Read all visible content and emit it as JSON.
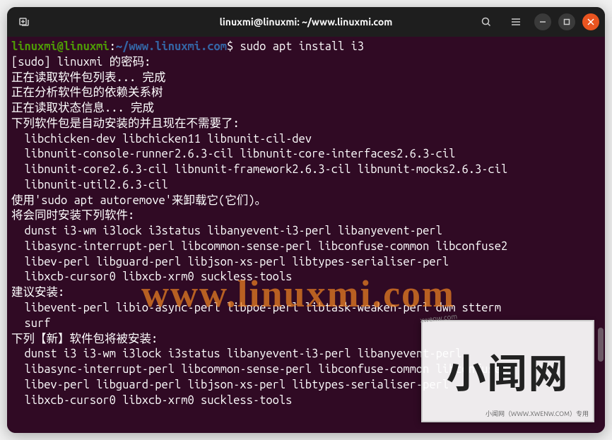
{
  "titlebar": {
    "title": "linuxmi@linuxmi: ~/www.linuxmi.com"
  },
  "prompt": {
    "user_host": "linuxmi@linuxmi",
    "sep": ":",
    "path": "~/www.linuxmi.com",
    "dollar": "$",
    "command": "sudo apt install i3"
  },
  "lines": {
    "l1": "[sudo] linuxmi 的密码:",
    "l2": "正在读取软件包列表... 完成",
    "l3": "正在分析软件包的依赖关系树",
    "l4": "正在读取状态信息... 完成",
    "l5": "下列软件包是自动安装的并且现在不需要了:",
    "l6": "libchicken-dev libchicken11 libnunit-cil-dev",
    "l7": "libnunit-console-runner2.6.3-cil libnunit-core-interfaces2.6.3-cil",
    "l8": "libnunit-core2.6.3-cil libnunit-framework2.6.3-cil libnunit-mocks2.6.3-cil",
    "l9": "libnunit-util2.6.3-cil",
    "l10": "使用'sudo apt autoremove'来卸载它(它们)。",
    "l11": "将会同时安装下列软件:",
    "l12": "dunst i3-wm i3lock i3status libanyevent-i3-perl libanyevent-perl",
    "l13": "libasync-interrupt-perl libcommon-sense-perl libconfuse-common libconfuse2",
    "l14": "libev-perl libguard-perl libjson-xs-perl libtypes-serialiser-perl",
    "l15": "libxcb-cursor0 libxcb-xrm0 suckless-tools",
    "l16": "建议安装:",
    "l17": "libevent-perl libio-async-perl libpoe-perl libtask-weaken-perl dwm stterm",
    "l18": "surf",
    "l19": "下列【新】软件包将被安装:",
    "l20": "dunst i3 i3-wm i3lock i3status libanyevent-i3-perl libanyevent-perl",
    "l21": "libasync-interrupt-perl libcommon-sense-perl libconfuse-common libconfuse2",
    "l22": "libev-perl libguard-perl libjson-xs-perl libtypes-serialiser-perl",
    "l23": "libxcb-cursor0 libxcb-xrm0 suckless-tools"
  },
  "watermark": {
    "url": "www.linuxmi.com",
    "logo_text": "小闻网",
    "logo_sub": "小闻网（WWW.XWENW.COM）专用",
    "logo_corner": "xwenw.com"
  }
}
